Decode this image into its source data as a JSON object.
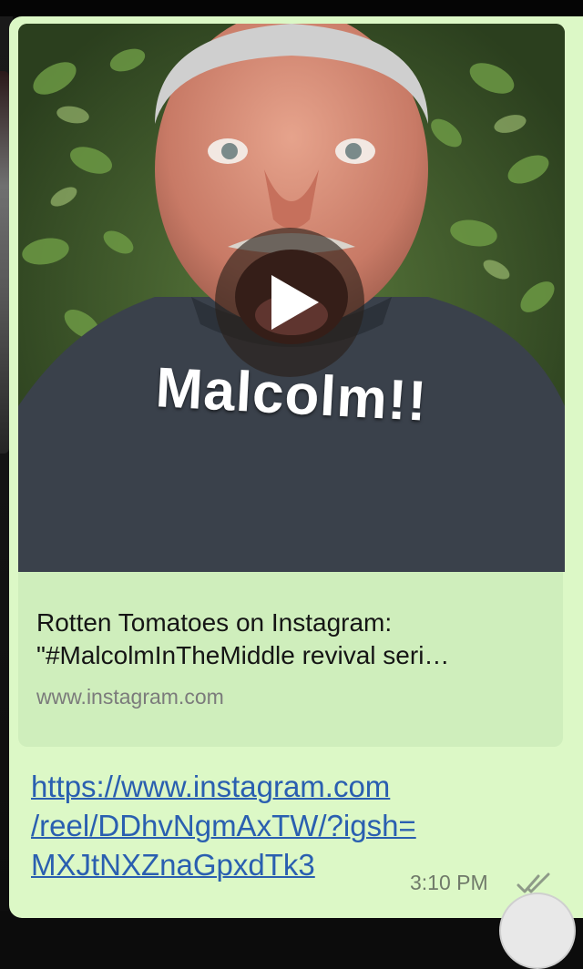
{
  "message": {
    "media_caption": "Malcolm!!",
    "link_preview": {
      "title_line1": "Rotten Tomatoes on Instagram:",
      "title_line2": "\"#MalcolmInTheMiddle revival seri…",
      "domain": "www.instagram.com"
    },
    "link_lines": [
      "https://www.instagram.com",
      "/reel/DDhvNgmAxTW/?igsh=",
      "MXJtNXZnaGpxdTk3"
    ],
    "time": "3:10 PM",
    "status_icon": "double-check-icon"
  },
  "colors": {
    "bubble": "#dcf8c6",
    "preview_card": "#cfeebc",
    "link": "#2a5fb0",
    "timestamp": "#707a6a"
  }
}
